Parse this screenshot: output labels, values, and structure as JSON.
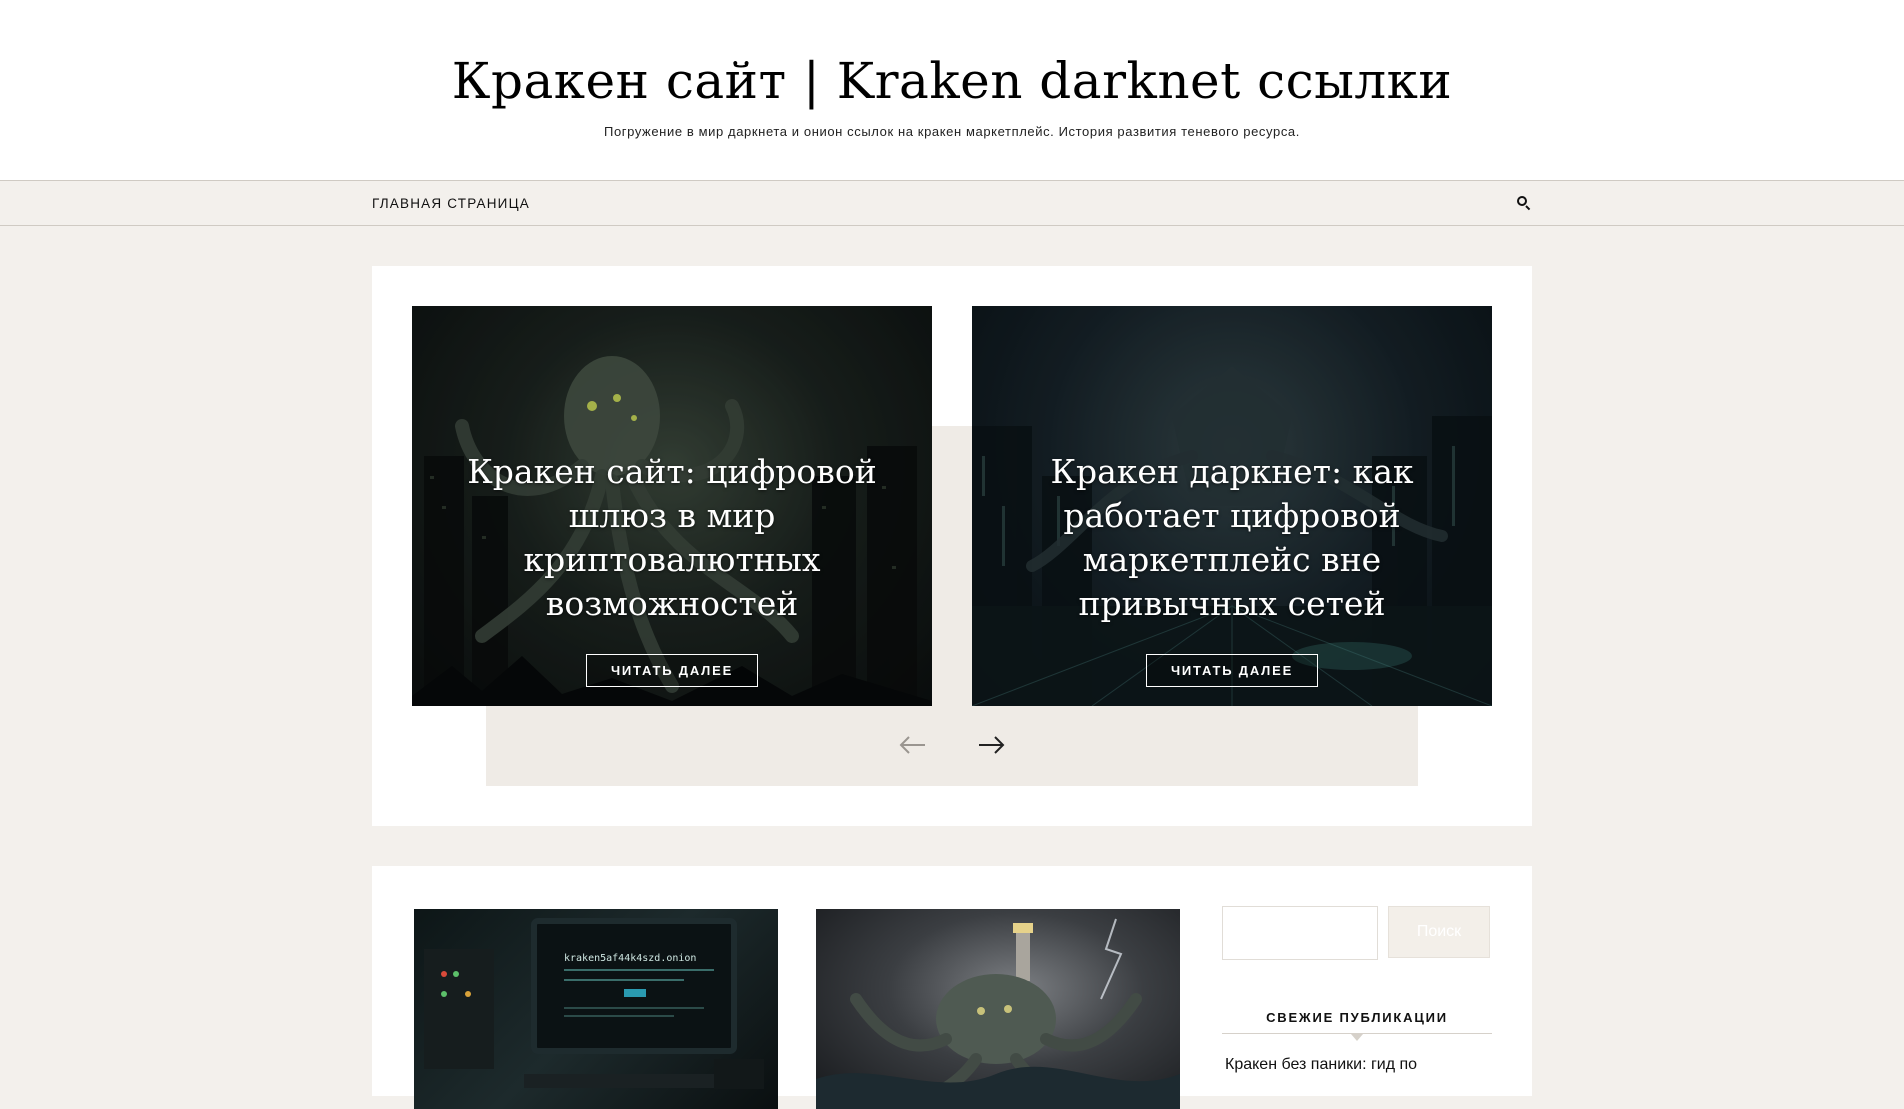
{
  "header": {
    "title": "Кракен сайт | Kraken darknet ссылки",
    "tagline": "Погружение в мир даркнета и онион ссылок на кракен маркетплейс. История развития теневого ресурса."
  },
  "nav": {
    "items": [
      {
        "label": "ГЛАВНАЯ СТРАНИЦА"
      }
    ],
    "search_icon": "search-icon"
  },
  "slider": {
    "slides": [
      {
        "title": "Кракен сайт: цифровой шлюз в мир криптовалютных возможностей",
        "button": "ЧИТАТЬ ДАЛЕЕ"
      },
      {
        "title": "Кракен даркнет: как работает цифровой маркетплейс вне привычных сетей",
        "button": "ЧИТАТЬ ДАЛЕЕ"
      }
    ],
    "prev_icon": "arrow-left-icon",
    "next_icon": "arrow-right-icon"
  },
  "posts": {
    "thumb1_screen_text": "kraken5af44k4szd.onion"
  },
  "sidebar": {
    "search_placeholder": "",
    "search_button": "Поиск",
    "recent_title": "СВЕЖИЕ ПУБЛИКАЦИИ",
    "recent_items": [
      {
        "label": "Кракен без паники: гид по"
      }
    ]
  }
}
